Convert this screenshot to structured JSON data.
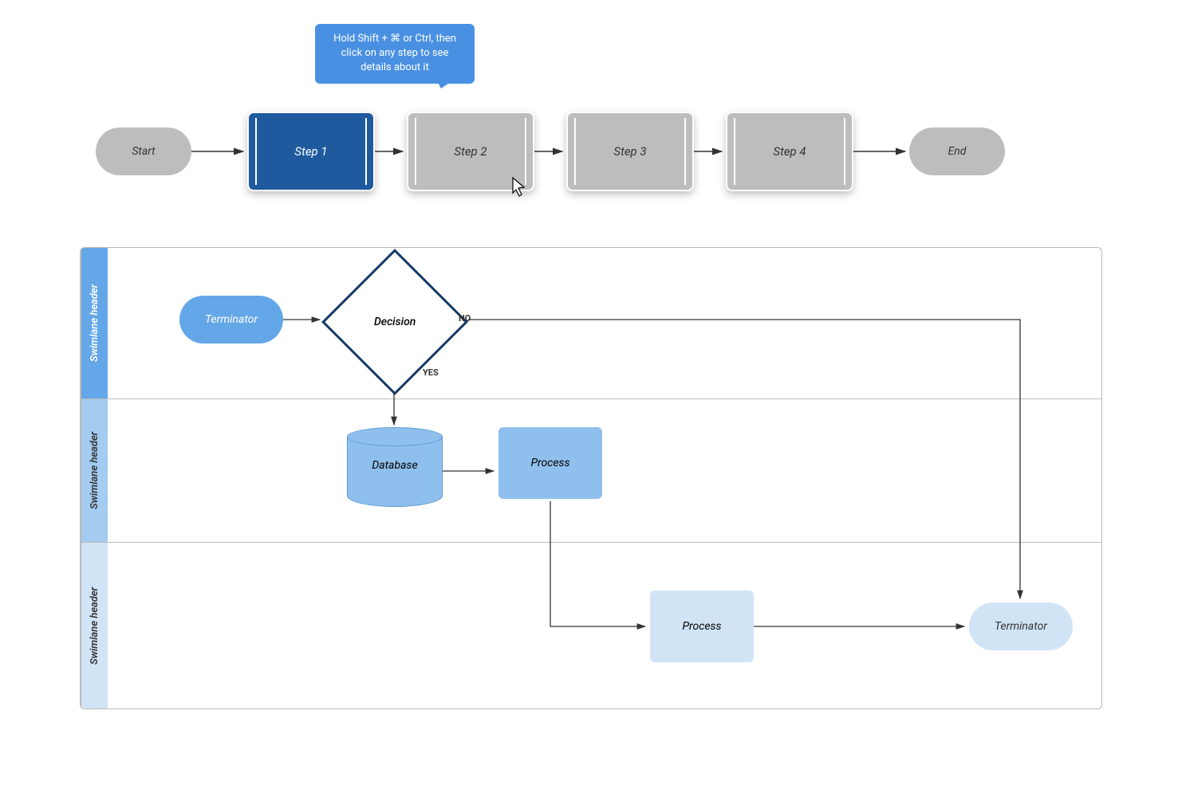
{
  "top_flow": {
    "start": "Start",
    "end": "End",
    "steps": [
      "Step 1",
      "Step 2",
      "Step 3",
      "Step 4"
    ],
    "tooltip": "Hold Shift + ⌘ or Ctrl, then click on any step to see details about it"
  },
  "swimlanes": {
    "headers": [
      "Swimlane header",
      "Swimlane header",
      "Swimlane header"
    ],
    "nodes": {
      "terminator1": "Terminator",
      "decision": "Decision",
      "decision_no": "NO",
      "decision_yes": "YES",
      "database": "Database",
      "process1": "Process",
      "process2": "Process",
      "terminator2": "Terminator"
    }
  }
}
